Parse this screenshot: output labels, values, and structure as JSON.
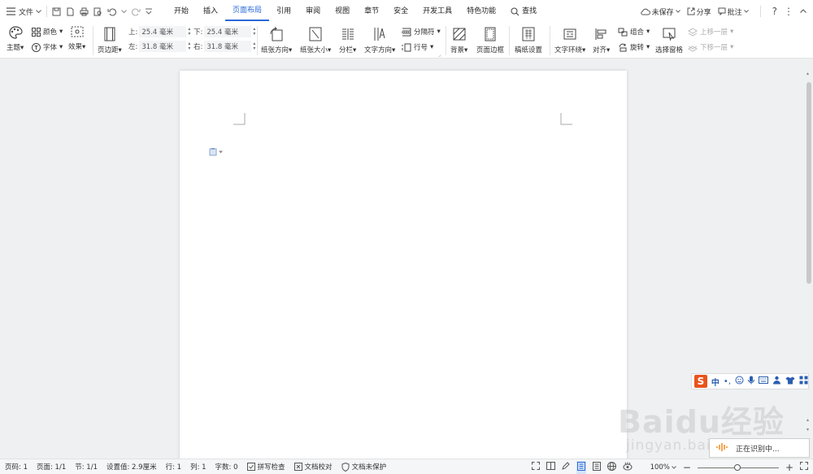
{
  "titlebar": {
    "file_label": "文件",
    "menu": [
      "开始",
      "插入",
      "页面布局",
      "引用",
      "审阅",
      "视图",
      "章节",
      "安全",
      "开发工具",
      "特色功能"
    ],
    "search_label": "查找",
    "unsaved_label": "未保存",
    "share_label": "分享",
    "comment_label": "批注"
  },
  "ribbon": {
    "theme": "主题",
    "color": "颜色",
    "font": "字体",
    "effect": "效果",
    "margins": "页边距",
    "top_label": "上:",
    "top_value": "25.4 毫米",
    "bottom_label": "下:",
    "bottom_value": "25.4 毫米",
    "left_label": "左:",
    "left_value": "31.8 毫米",
    "right_label": "右:",
    "right_value": "31.8 毫米",
    "orientation": "纸张方向",
    "size": "纸张大小",
    "columns": "分栏",
    "text_direction": "文字方向",
    "breaks": "分隔符",
    "line_numbers": "行号",
    "background": "背景",
    "page_border": "页面边框",
    "draft_paper": "稿纸设置",
    "wrap_text": "文字环绕",
    "align": "对齐",
    "group": "组合",
    "rotate": "旋转",
    "selection_pane": "选择窗格",
    "bring_forward": "上移一层",
    "send_backward": "下移一层"
  },
  "status": {
    "page_num": "页码: 1",
    "pages": "页面: 1/1",
    "section": "节: 1/1",
    "position": "设置值: 2.9厘米",
    "row": "行: 1",
    "col": "列: 1",
    "words": "字数: 0",
    "spell": "拼写检查",
    "proof": "文档校对",
    "protect": "文档未保护",
    "zoom": "100%"
  },
  "ime": {
    "logo": "S",
    "mode": "中"
  },
  "toast": {
    "text": "正在识别中..."
  },
  "watermark": {
    "text": "Baidu经验",
    "sub": "jingyan.baidu.com"
  }
}
